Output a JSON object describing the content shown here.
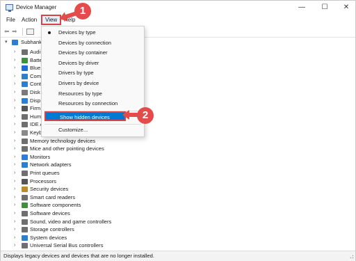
{
  "window": {
    "title": "Device Manager",
    "buttons": {
      "minimize": "—",
      "maximize": "☐",
      "close": "✕"
    }
  },
  "menubar": {
    "file": "File",
    "action": "Action",
    "view": "View",
    "help": "Help"
  },
  "tree": {
    "root": "Subhank",
    "nodes": [
      {
        "label": "Audi",
        "icon": "speaker-icon",
        "color": "#6f6f6f"
      },
      {
        "label": "Batte",
        "icon": "battery-icon",
        "color": "#3f8f3f"
      },
      {
        "label": "Blue",
        "icon": "bluetooth-icon",
        "color": "#1f6fd1"
      },
      {
        "label": "Com",
        "icon": "monitor-icon",
        "color": "#2a7fd4"
      },
      {
        "label": "Cont",
        "icon": "controller-icon",
        "color": "#2a7fd4"
      },
      {
        "label": "Disk",
        "icon": "disk-icon",
        "color": "#7a7a7a"
      },
      {
        "label": "Disp",
        "icon": "display-icon",
        "color": "#2a7fd4"
      },
      {
        "label": "Firm",
        "icon": "chip-icon",
        "color": "#555555"
      },
      {
        "label": "Hum",
        "icon": "hid-icon",
        "color": "#6f6f6f"
      },
      {
        "label": "IDE A",
        "icon": "ide-icon",
        "color": "#6f6f6f"
      },
      {
        "label": "Keyb",
        "icon": "keyboard-icon",
        "color": "#8a8a8a"
      },
      {
        "label": "Memory technology devices",
        "icon": "memory-icon",
        "color": "#6f6f6f"
      },
      {
        "label": "Mice and other pointing devices",
        "icon": "mouse-icon",
        "color": "#6f6f6f"
      },
      {
        "label": "Monitors",
        "icon": "monitor-icon",
        "color": "#2a7fd4"
      },
      {
        "label": "Network adapters",
        "icon": "network-icon",
        "color": "#2a7fd4"
      },
      {
        "label": "Print queues",
        "icon": "printer-icon",
        "color": "#6f6f6f"
      },
      {
        "label": "Processors",
        "icon": "processor-icon",
        "color": "#555555"
      },
      {
        "label": "Security devices",
        "icon": "security-icon",
        "color": "#c08a2a"
      },
      {
        "label": "Smart card readers",
        "icon": "smartcard-icon",
        "color": "#6f6f6f"
      },
      {
        "label": "Software components",
        "icon": "component-icon",
        "color": "#3f8f3f"
      },
      {
        "label": "Software devices",
        "icon": "software-icon",
        "color": "#6f6f6f"
      },
      {
        "label": "Sound, video and game controllers",
        "icon": "sound-icon",
        "color": "#6f6f6f"
      },
      {
        "label": "Storage controllers",
        "icon": "storage-icon",
        "color": "#6f6f6f"
      },
      {
        "label": "System devices",
        "icon": "system-icon",
        "color": "#2a7fd4"
      },
      {
        "label": "Universal Serial Bus controllers",
        "icon": "usb-icon",
        "color": "#6f6f6f"
      }
    ]
  },
  "view_menu": {
    "items": [
      {
        "label": "Devices by type",
        "selected": true
      },
      {
        "label": "Devices by connection"
      },
      {
        "label": "Devices by container"
      },
      {
        "label": "Devices by driver"
      },
      {
        "label": "Drivers by type"
      },
      {
        "label": "Drivers by device"
      },
      {
        "label": "Resources by type"
      },
      {
        "label": "Resources by connection"
      }
    ],
    "show_hidden": "Show hidden devices",
    "customize": "Customize..."
  },
  "callouts": {
    "one": "1",
    "two": "2"
  },
  "statusbar": {
    "text": "Displays legacy devices and devices that are no longer installed."
  },
  "colors": {
    "accent": "#0078d4",
    "annotation_red": "#e44b4b",
    "menu_bg": "#f9f9f9"
  }
}
